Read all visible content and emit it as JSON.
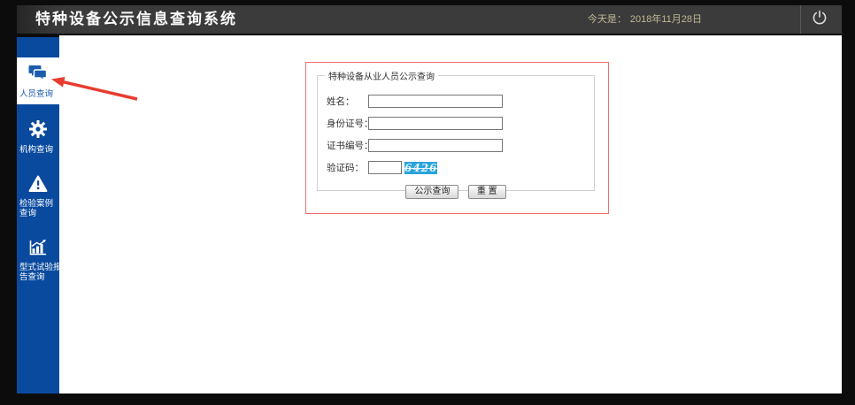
{
  "header": {
    "title": "特种设备公示信息查询系统",
    "date_prefix": "今天是：",
    "date_value": "2018年11月28日"
  },
  "sidebar": {
    "items": [
      {
        "label": "人员查询",
        "line1": "人员查询",
        "line2": "",
        "icon": "chat-bubbles-icon",
        "active": true
      },
      {
        "label": "机构查询",
        "line1": "机构查询",
        "line2": "",
        "icon": "gear-icon",
        "active": false
      },
      {
        "label": "检验案例查询",
        "line1": "检验案例",
        "line2": "查询",
        "icon": "warning-icon",
        "active": false
      },
      {
        "label": "型式试验报告查询",
        "line1": "型式试验报",
        "line2": "告查询",
        "icon": "bar-chart-icon",
        "active": false
      }
    ]
  },
  "form": {
    "legend": "特种设备从业人员公示查询",
    "fields": {
      "name": {
        "label": "姓名：",
        "value": ""
      },
      "id_number": {
        "label": "身份证号：",
        "value": ""
      },
      "cert_number": {
        "label": "证书编号：",
        "value": ""
      },
      "captcha": {
        "label": "验证码：",
        "value": "",
        "code": "6426"
      }
    },
    "buttons": {
      "query": "公示查询",
      "reset": "重 置"
    }
  },
  "annotation": {
    "type": "red-arrow",
    "points_to": "人员查询"
  },
  "colors": {
    "header_bg": "#3b3b3b",
    "sidebar_blue": "#0a4a9e",
    "active_item_bg": "#ffffff",
    "captcha_bg": "#2aa3dc",
    "highlight_border_red": "#f26d6d",
    "arrow_red": "#e73c2e",
    "date_text": "#c2b996"
  }
}
